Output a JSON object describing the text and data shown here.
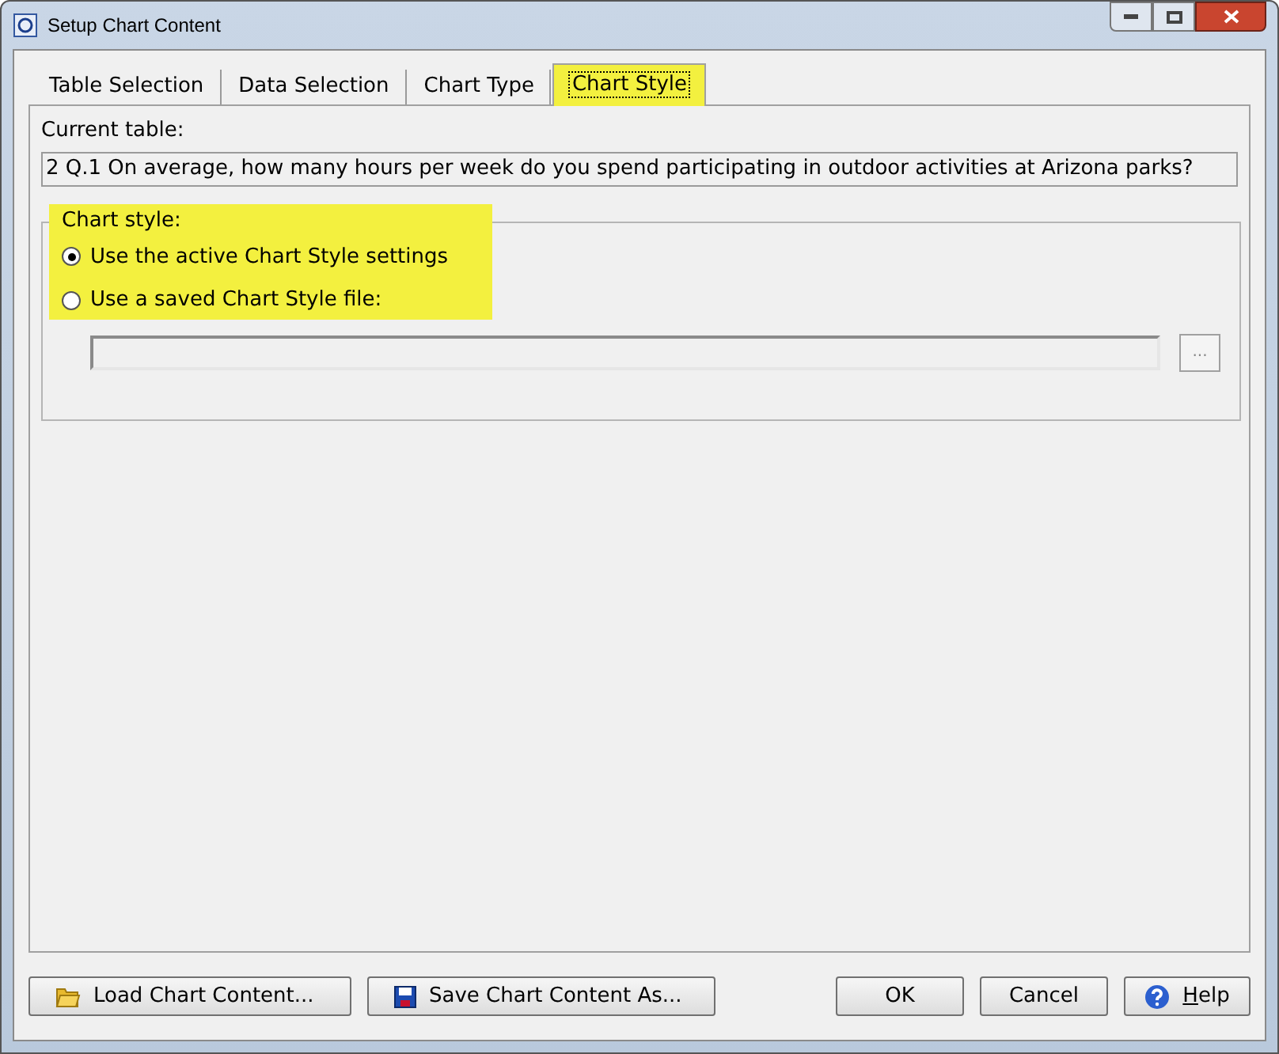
{
  "window": {
    "title": "Setup Chart Content"
  },
  "tabs": [
    {
      "label": "Table Selection",
      "selected": false,
      "highlighted": false
    },
    {
      "label": "Data Selection",
      "selected": false,
      "highlighted": false
    },
    {
      "label": "Chart Type",
      "selected": false,
      "highlighted": false
    },
    {
      "label": "Chart Style",
      "selected": true,
      "highlighted": true
    }
  ],
  "current_table": {
    "label": "Current table:",
    "value": "2 Q.1 On average, how many hours per week do you spend participating in outdoor activities at Arizona parks?"
  },
  "chart_style": {
    "title": "Chart style:",
    "highlighted": true,
    "options": [
      {
        "label": "Use the active Chart Style settings",
        "selected": true
      },
      {
        "label": "Use a saved Chart Style file:",
        "selected": false
      }
    ],
    "file_field": {
      "disabled": true
    },
    "browse_button": "..."
  },
  "buttons": [
    {
      "kind": "load",
      "label": "Load Chart Content..."
    },
    {
      "kind": "save",
      "label": "Save Chart Content As..."
    },
    {
      "kind": "plain",
      "label": "OK"
    },
    {
      "kind": "plain",
      "label": "Cancel"
    },
    {
      "kind": "help",
      "label": "Help"
    }
  ]
}
